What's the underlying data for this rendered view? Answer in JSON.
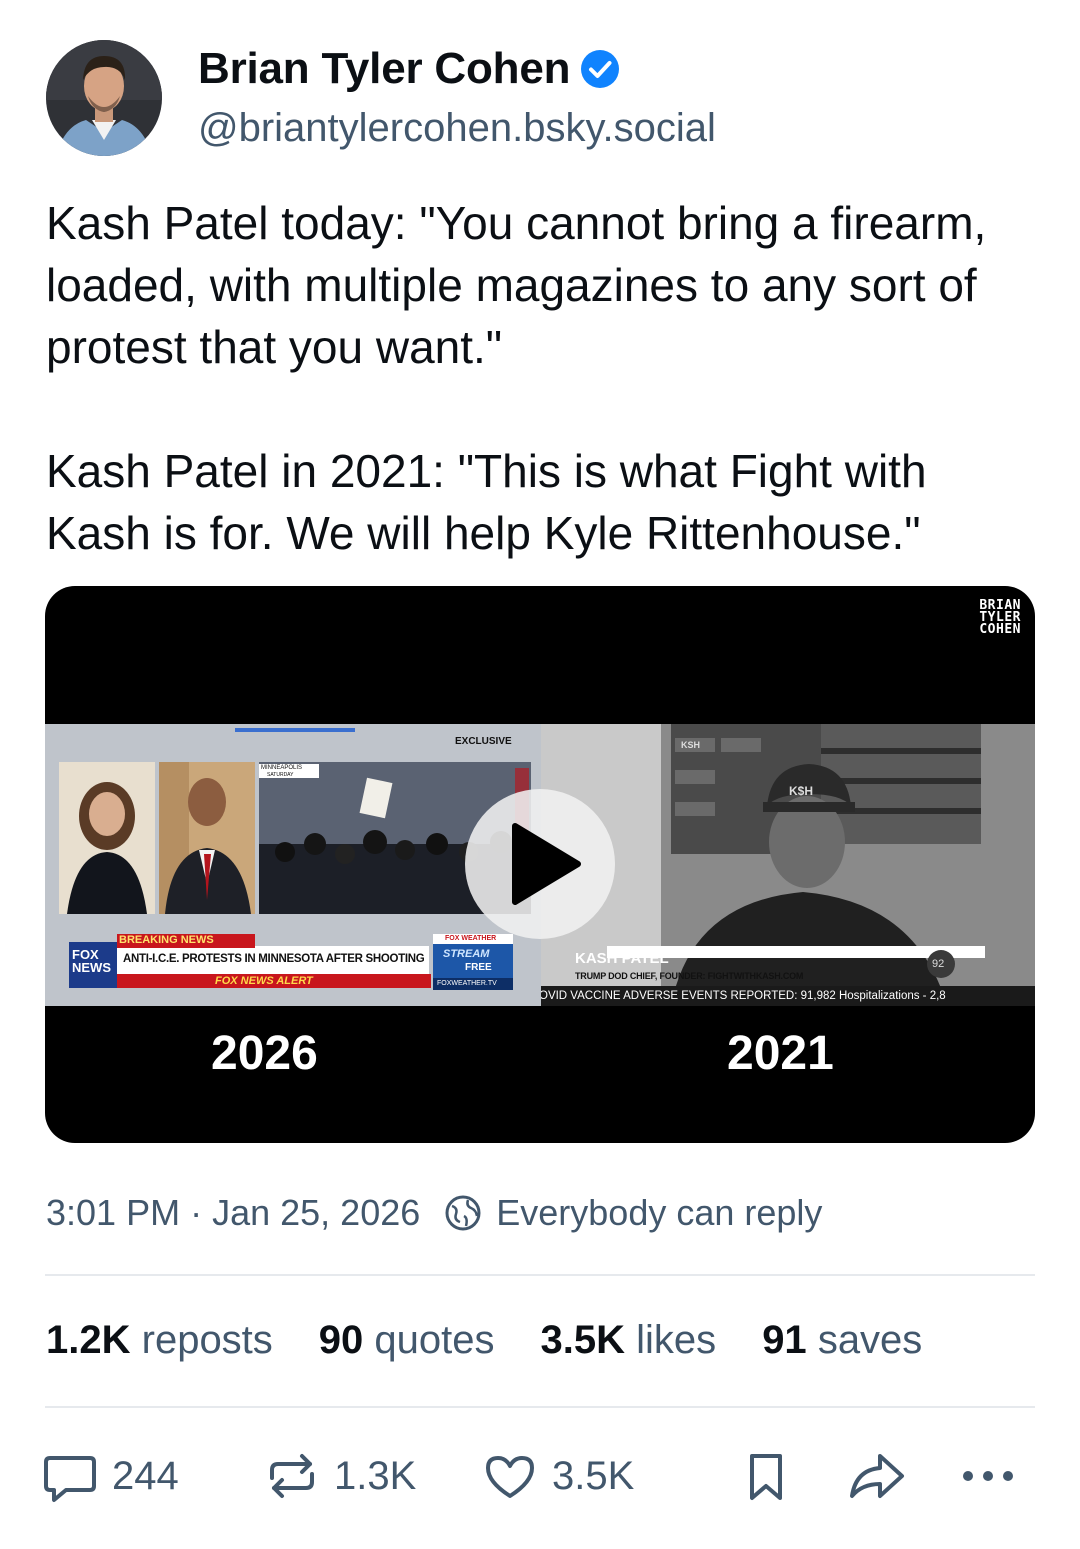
{
  "author": {
    "name": "Brian Tyler Cohen",
    "handle": "@briantylercohen.bsky.social"
  },
  "post": {
    "paragraph1": "Kash Patel today: \"You cannot bring a firearm, loaded, with multiple magazines to any sort of protest that you want.\"",
    "paragraph2": "Kash Patel in 2021: \"This is what Fight with Kash is for. We will help Kyle Rittenhouse.\""
  },
  "video": {
    "watermark_line1": "BRIAN",
    "watermark_line2": "TYLER",
    "watermark_line3": "COHEN",
    "left_year": "2026",
    "right_year": "2021",
    "left_clip": {
      "exclusive": "EXCLUSIVE",
      "location": "MINNEAPOLIS",
      "day": "SATURDAY",
      "breaking": "BREAKING NEWS",
      "headline": "ANTI-I.C.E. PROTESTS IN MINNESOTA AFTER SHOOTING",
      "alert": "FOX NEWS ALERT",
      "fox_logo_1": "FOX",
      "fox_logo_2": "NEWS",
      "weather_label": "FOX WEATHER",
      "stream_label": "STREAM",
      "free_label": "FREE",
      "weather_url": "FOXWEATHER.TV"
    },
    "right_clip": {
      "hat": "K$H",
      "sign": "KSH",
      "name": "KASH PATEL",
      "title": "TRUMP DOD CHIEF, FOUNDER: FIGHTWITHKASH.COM",
      "ticker": "OVID VACCINE ADVERSE EVENTS REPORTED:   91,982 Hospitalizations - 2,8",
      "badge": "92"
    }
  },
  "meta": {
    "time": "3:01 PM",
    "separator": "·",
    "date": "Jan 25, 2026",
    "reply_setting": "Everybody can reply"
  },
  "stats": {
    "reposts_count": "1.2K",
    "reposts_label": "reposts",
    "quotes_count": "90",
    "quotes_label": "quotes",
    "likes_count": "3.5K",
    "likes_label": "likes",
    "saves_count": "91",
    "saves_label": "saves"
  },
  "actions": {
    "reply_count": "244",
    "repost_count": "1.3K",
    "like_count": "3.5K"
  },
  "colors": {
    "verified_blue": "#1083fe",
    "secondary_text": "#42576c",
    "fox_red": "#c8161d",
    "fox_blue": "#1c3b8a"
  },
  "icons": [
    "verified-icon",
    "globe-icon",
    "reply-icon",
    "repost-icon",
    "like-icon",
    "bookmark-icon",
    "share-icon",
    "more-icon",
    "play-icon"
  ]
}
